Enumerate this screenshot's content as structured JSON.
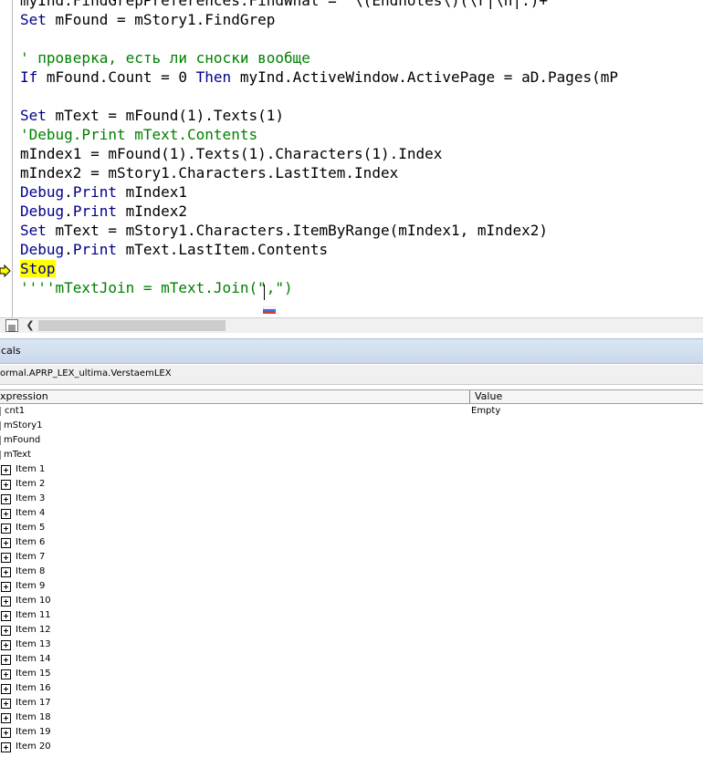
{
  "editor": {
    "lines": [
      [
        {
          "t": "myInd.FindGrepPreferences.FindWhat = \"\\(Endnotes\\)(\\r|\\n|.)+\"",
          "c": "tx"
        }
      ],
      [
        {
          "t": "Set",
          "c": "kw"
        },
        {
          "t": " mFound = mStory1.FindGrep",
          "c": "tx"
        }
      ],
      [],
      [
        {
          "t": "' проверка, есть ли сноски вообще",
          "c": "cm"
        }
      ],
      [
        {
          "t": "If",
          "c": "kw"
        },
        {
          "t": " mFound.Count = 0 ",
          "c": "tx"
        },
        {
          "t": "Then",
          "c": "kw"
        },
        {
          "t": " myInd.ActiveWindow.ActivePage = aD.Pages(mP",
          "c": "tx"
        }
      ],
      [],
      [
        {
          "t": "Set",
          "c": "kw"
        },
        {
          "t": " mText = mFound(1).Texts(1)",
          "c": "tx"
        }
      ],
      [
        {
          "t": "'Debug.Print mText.Contents",
          "c": "cm"
        }
      ],
      [
        {
          "t": "mIndex1 = mFound(1).Texts(1).Characters(1).Index",
          "c": "tx"
        }
      ],
      [
        {
          "t": "mIndex2 = mStory1.Characters.LastItem.Index",
          "c": "tx"
        }
      ],
      [
        {
          "t": "Debug",
          "c": "kw"
        },
        {
          "t": ".",
          "c": "tx"
        },
        {
          "t": "Print",
          "c": "kw"
        },
        {
          "t": " mIndex1",
          "c": "tx"
        }
      ],
      [
        {
          "t": "Debug",
          "c": "kw"
        },
        {
          "t": ".",
          "c": "tx"
        },
        {
          "t": "Print",
          "c": "kw"
        },
        {
          "t": " mIndex2",
          "c": "tx"
        }
      ],
      [
        {
          "t": "Set",
          "c": "kw"
        },
        {
          "t": " mText = mStory1.Characters.ItemByRange(mIndex1, mIndex2)",
          "c": "tx"
        }
      ],
      [
        {
          "t": "Debug",
          "c": "kw"
        },
        {
          "t": ".",
          "c": "tx"
        },
        {
          "t": "Print",
          "c": "kw"
        },
        {
          "t": " mText.LastItem.Contents",
          "c": "tx"
        }
      ],
      [
        {
          "t": "Stop",
          "c": "stop"
        }
      ],
      [
        {
          "t": "''''mTextJoin = mText.Join(\",\")",
          "c": "cm"
        }
      ]
    ]
  },
  "locals": {
    "title": "cals",
    "context": "ormal.APRP_LEX_ultima.VerstaemLEX",
    "columns": {
      "expression": "xpression",
      "value": "Value"
    },
    "rows": [
      {
        "name": "cnt1",
        "value": "Empty",
        "expandable": false,
        "level": 0
      },
      {
        "name": "mStory1",
        "value": "",
        "expandable": false,
        "level": 0
      },
      {
        "name": "mFound",
        "value": "",
        "expandable": false,
        "level": 0
      },
      {
        "name": "mText",
        "value": "",
        "expandable": false,
        "level": 0
      },
      {
        "name": "Item 1",
        "value": "",
        "expandable": true,
        "level": 1
      },
      {
        "name": "Item 2",
        "value": "",
        "expandable": true,
        "level": 1
      },
      {
        "name": "Item 3",
        "value": "",
        "expandable": true,
        "level": 1
      },
      {
        "name": "Item 4",
        "value": "",
        "expandable": true,
        "level": 1
      },
      {
        "name": "Item 5",
        "value": "",
        "expandable": true,
        "level": 1
      },
      {
        "name": "Item 6",
        "value": "",
        "expandable": true,
        "level": 1
      },
      {
        "name": "Item 7",
        "value": "",
        "expandable": true,
        "level": 1
      },
      {
        "name": "Item 8",
        "value": "",
        "expandable": true,
        "level": 1
      },
      {
        "name": "Item 9",
        "value": "",
        "expandable": true,
        "level": 1
      },
      {
        "name": "Item 10",
        "value": "",
        "expandable": true,
        "level": 1
      },
      {
        "name": "Item 11",
        "value": "",
        "expandable": true,
        "level": 1
      },
      {
        "name": "Item 12",
        "value": "",
        "expandable": true,
        "level": 1
      },
      {
        "name": "Item 13",
        "value": "",
        "expandable": true,
        "level": 1
      },
      {
        "name": "Item 14",
        "value": "",
        "expandable": true,
        "level": 1
      },
      {
        "name": "Item 15",
        "value": "",
        "expandable": true,
        "level": 1
      },
      {
        "name": "Item 16",
        "value": "",
        "expandable": true,
        "level": 1
      },
      {
        "name": "Item 17",
        "value": "",
        "expandable": true,
        "level": 1
      },
      {
        "name": "Item 18",
        "value": "",
        "expandable": true,
        "level": 1
      },
      {
        "name": "Item 19",
        "value": "",
        "expandable": true,
        "level": 1
      },
      {
        "name": "Item 20",
        "value": "",
        "expandable": true,
        "level": 1
      }
    ]
  },
  "icons": {
    "exec_arrow": "current-statement-arrow-icon",
    "expand": "plus-box-icon",
    "language_flag": "language-flag-icon",
    "full_module_view": "full-module-view-icon",
    "scroll_left": "chevron-left-icon"
  },
  "colors": {
    "keyword": "#00008b",
    "comment": "#008000",
    "stop_highlight": "#ffff00"
  }
}
